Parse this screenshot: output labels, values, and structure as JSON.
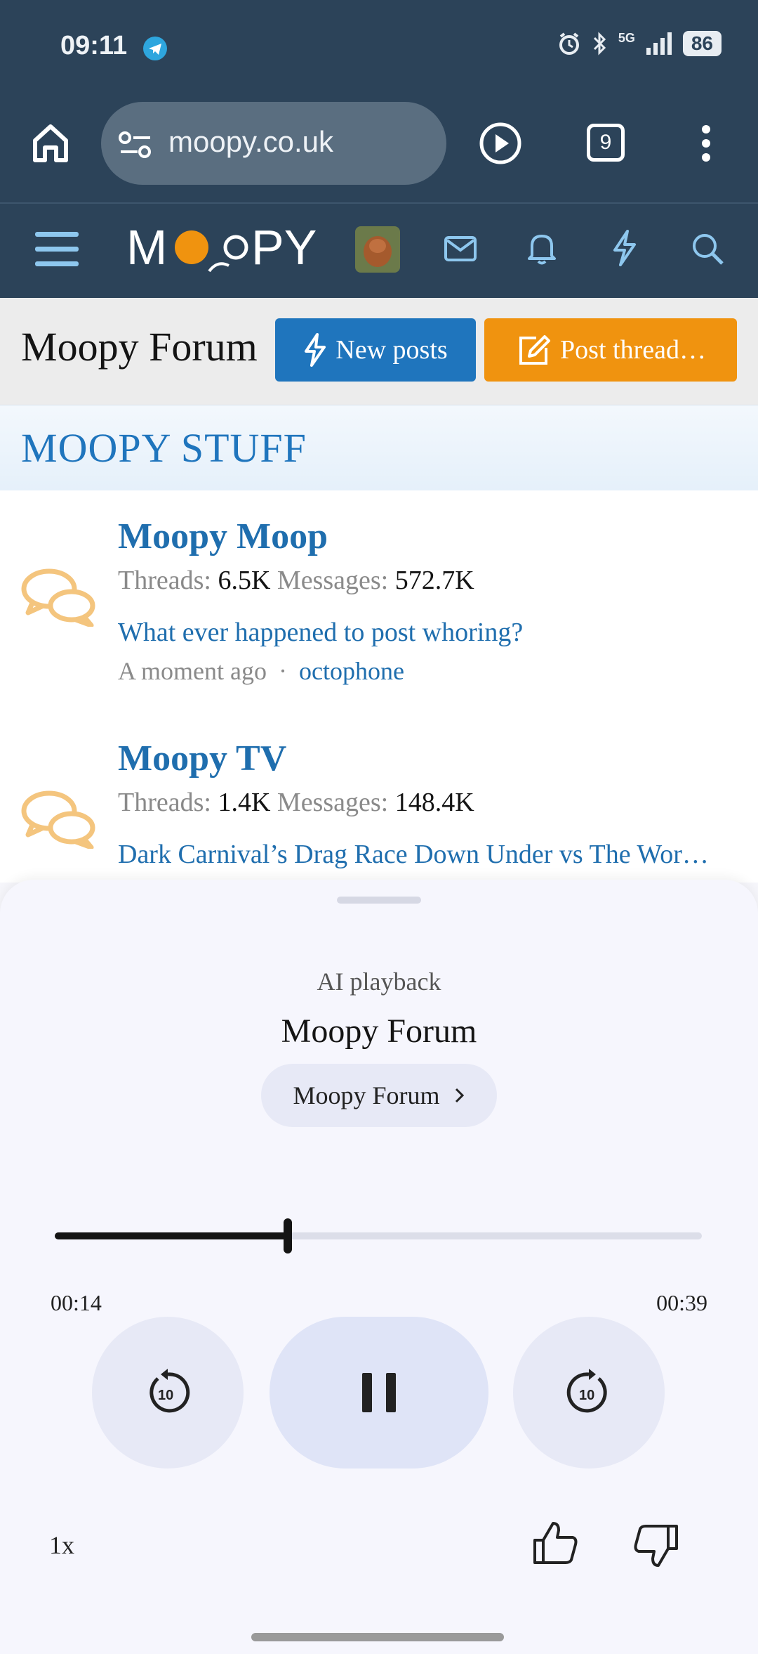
{
  "status_bar": {
    "time": "09:11",
    "network": "5G",
    "battery": "86"
  },
  "browser": {
    "url": "moopy.co.uk",
    "tab_count": "9"
  },
  "site": {
    "logo": "MOOPY"
  },
  "page": {
    "title": "Moopy Forum",
    "new_posts_label": "New posts",
    "post_thread_label": "Post thread…"
  },
  "category": {
    "title": "MOOPY STUFF"
  },
  "forums": [
    {
      "name": "Moopy Moop",
      "threads_label": "Threads:",
      "threads": "6.5K",
      "messages_label": "Messages:",
      "messages": "572.7K",
      "latest_title": "What ever happened to post whoring?",
      "latest_time": "A moment ago",
      "separator": "·",
      "latest_user": "octophone"
    },
    {
      "name": "Moopy TV",
      "threads_label": "Threads:",
      "threads": "1.4K",
      "messages_label": "Messages:",
      "messages": "148.4K",
      "latest_title": "Dark Carnival’s Drag Race Down Under vs The Wor…"
    }
  ],
  "player": {
    "label": "AI playback",
    "title": "Moopy Forum",
    "chip_label": "Moopy Forum",
    "current_time": "00:14",
    "total_time": "00:39",
    "progress": 0.36,
    "speed": "1x"
  },
  "colors": {
    "header_bg": "#2c4359",
    "link_blue": "#1f75bd",
    "accent_orange": "#f0930f"
  }
}
